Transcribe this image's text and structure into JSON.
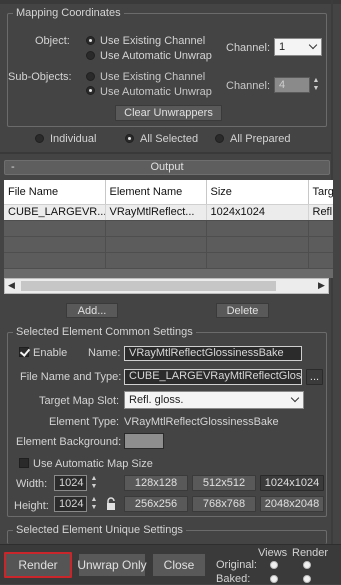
{
  "mapping": {
    "title": "Mapping Coordinates",
    "object_label": "Object:",
    "object_options": [
      "Use Existing Channel",
      "Use Automatic Unwrap"
    ],
    "object_selected": 0,
    "channel_label": "Channel:",
    "object_channel": "1",
    "subobjects_label": "Sub-Objects:",
    "sub_options": [
      "Use Existing Channel",
      "Use Automatic Unwrap"
    ],
    "sub_selected": 1,
    "sub_channel": "4",
    "clear_button": "Clear Unwrappers",
    "bake_modes": [
      "Individual",
      "All Selected",
      "All Prepared"
    ],
    "bake_selected": 1
  },
  "output": {
    "collapse": "-",
    "title": "Output",
    "columns": [
      "File Name",
      "Element Name",
      "Size",
      "Targ"
    ],
    "rows": [
      [
        "CUBE_LARGEVR...",
        "VRayMtlReflect...",
        "1024x1024",
        "Refl"
      ]
    ],
    "add_button": "Add...",
    "delete_button": "Delete"
  },
  "common": {
    "title": "Selected Element Common Settings",
    "enable_label": "Enable",
    "enable_checked": true,
    "name_label": "Name:",
    "name_value": "VRayMtlReflectGlossinessBake",
    "file_label": "File Name and Type:",
    "file_value": "CUBE_LARGEVRayMtlReflectGlossir",
    "browse_button": "...",
    "target_label": "Target Map Slot:",
    "target_value": "Refl. gloss.",
    "elemtype_label": "Element Type:",
    "elemtype_value": "VRayMtlReflectGlossinessBake",
    "background_label": "Element Background:",
    "background_color": "#8e8e8e",
    "auto_size_label": "Use Automatic Map Size",
    "auto_size_checked": false,
    "width_label": "Width:",
    "width_value": "1024",
    "height_label": "Height:",
    "height_value": "1024",
    "size_presets": [
      [
        "128x128",
        "512x512",
        "1024x1024"
      ],
      [
        "256x256",
        "768x768",
        "2048x2048"
      ]
    ]
  },
  "unique": {
    "title": "Selected Element Unique Settings"
  },
  "footer": {
    "render": "Render",
    "unwrap_only": "Unwrap Only",
    "close": "Close",
    "views_label": "Views",
    "render_label": "Render",
    "original_label": "Original:",
    "baked_label": "Baked:",
    "accent": "#c8262a"
  }
}
